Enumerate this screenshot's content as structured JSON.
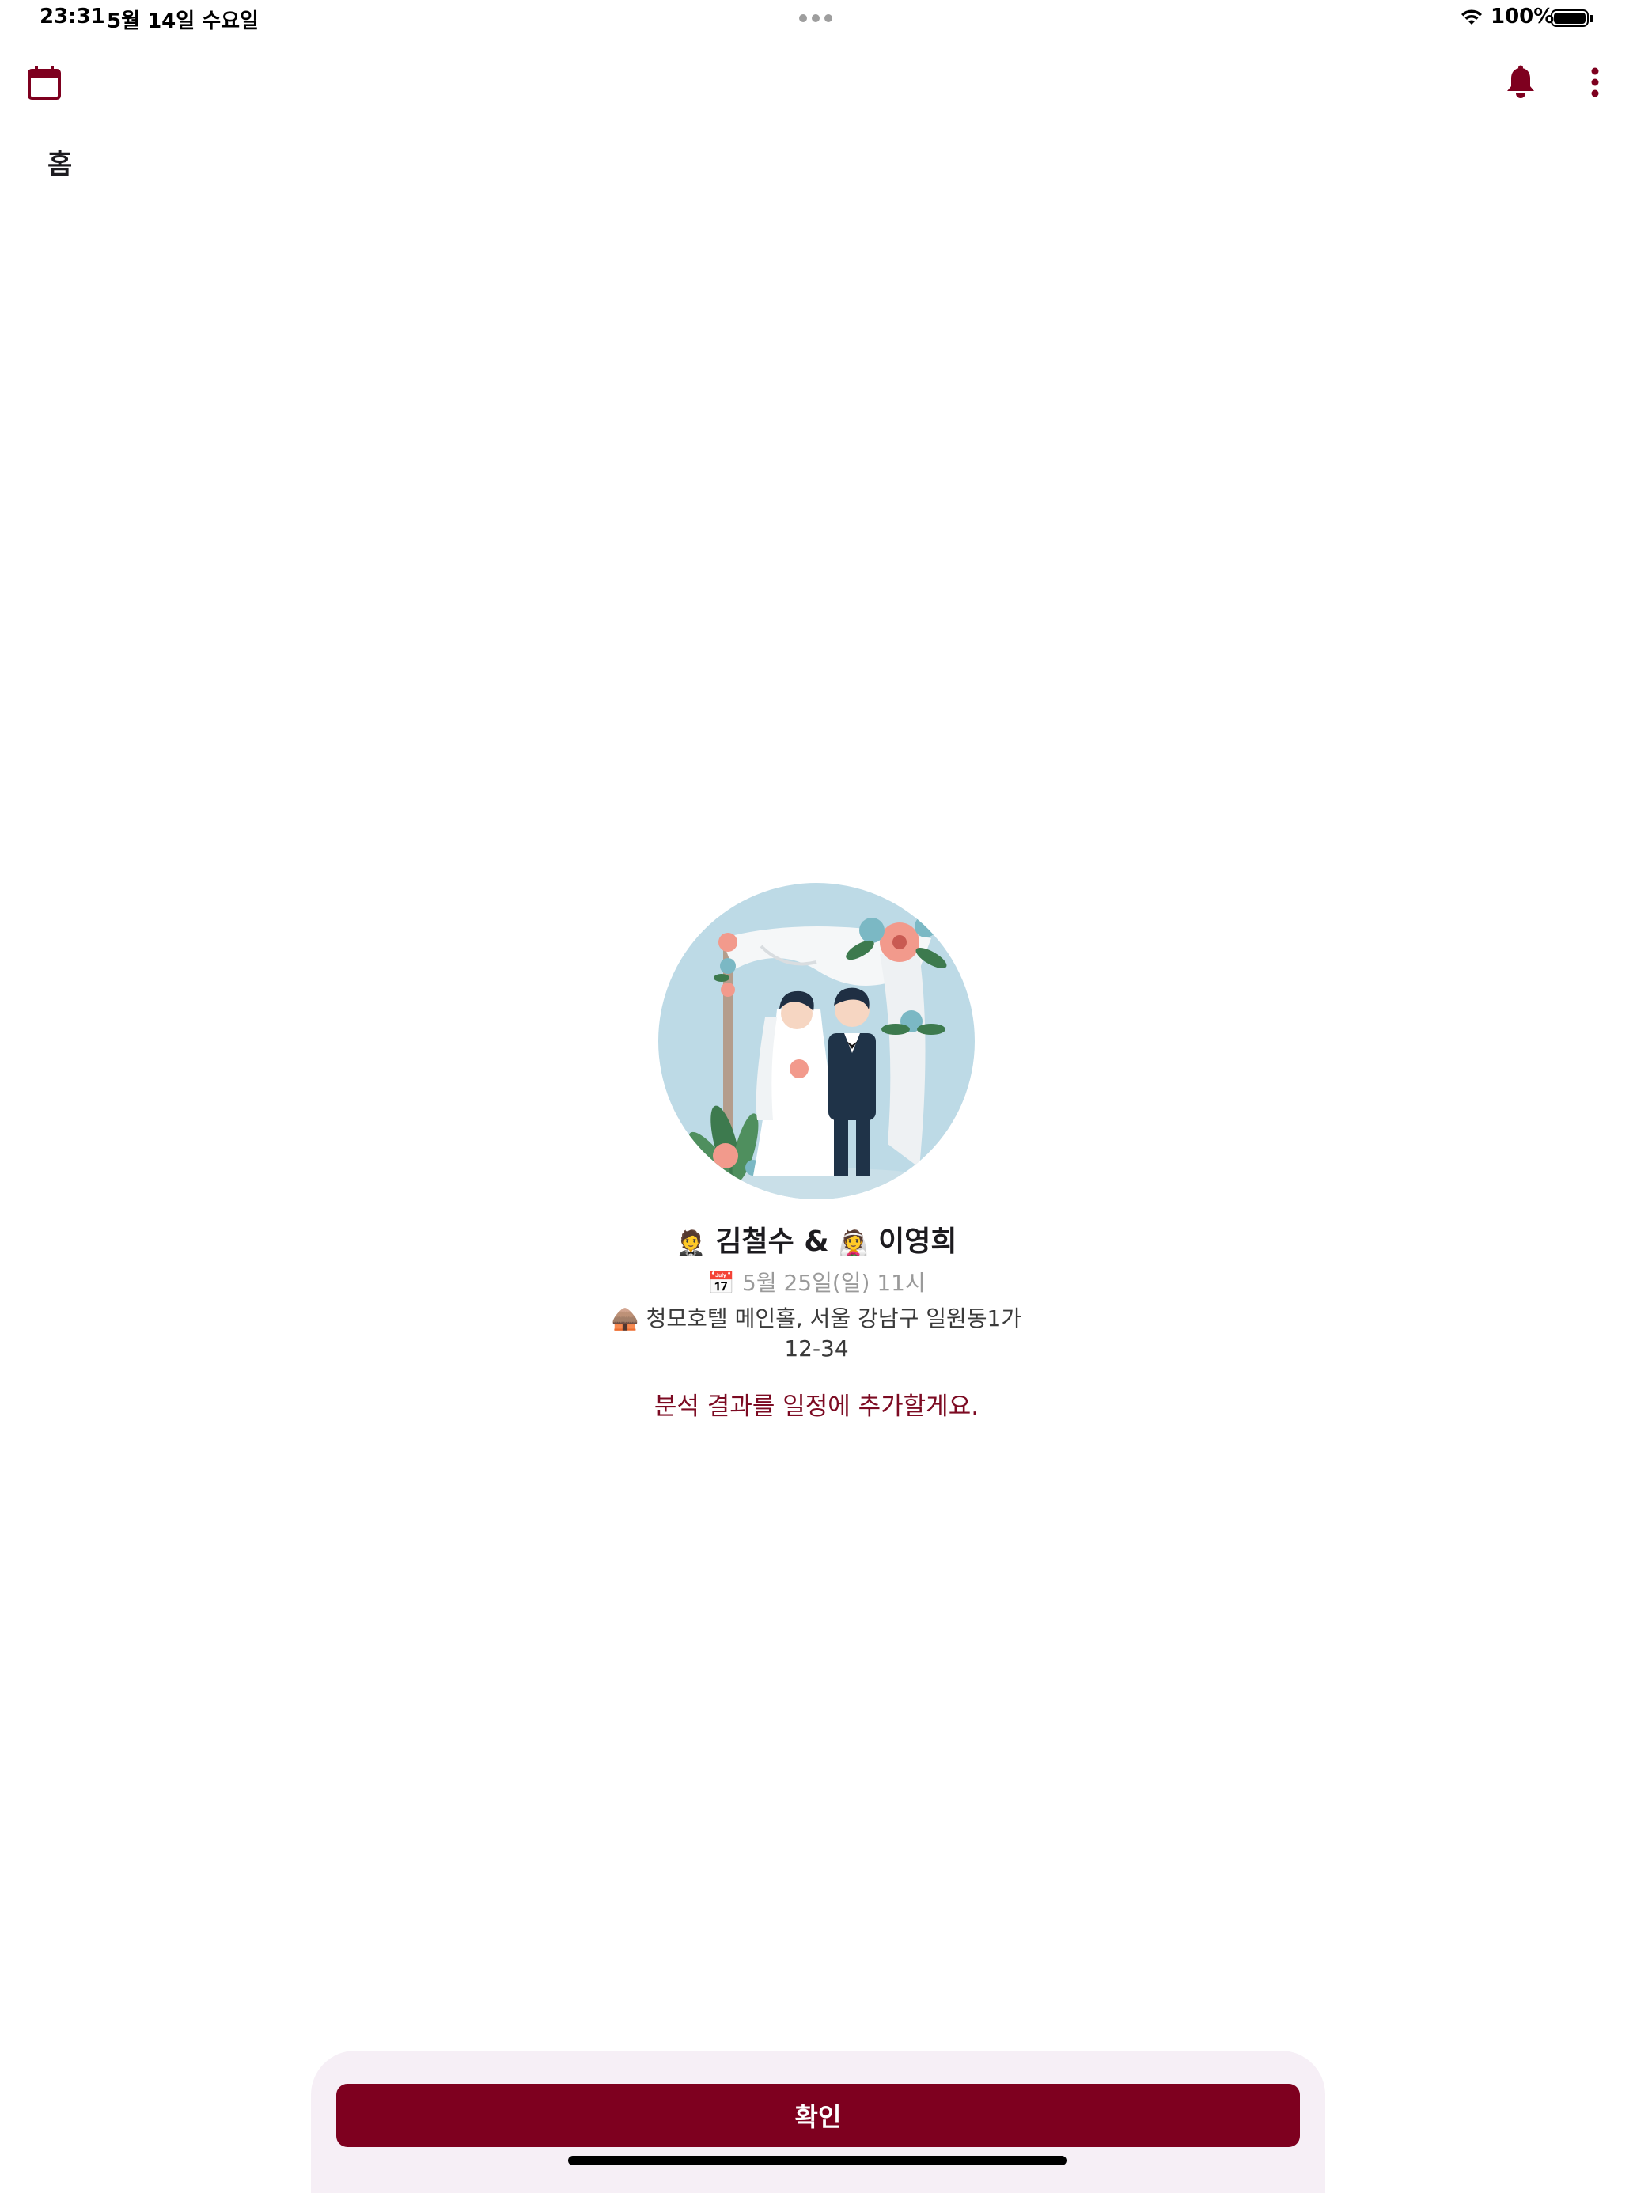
{
  "status_bar": {
    "time": "23:31",
    "date": "5월 14일 수요일",
    "battery": "100%"
  },
  "app_bar": {
    "tab_label": "홈",
    "icons": [
      "calendar-icon",
      "bell-icon",
      "more-vert-icon"
    ]
  },
  "event": {
    "groom_emoji": "🤵",
    "groom": "김철수",
    "amp": "&",
    "bride_emoji": "👰",
    "bride": "이영희",
    "date_emoji": "📅",
    "datetime": "5월 25일(일) 11시",
    "place_emoji": "🛖",
    "address_line1": "청모호텔 메인홀, 서울 강남구 일원동1가",
    "address_line2": "12-34"
  },
  "notice": "분석 결과를 일정에 추가할게요.",
  "confirm_button": "확인",
  "colors": {
    "accent": "#7e001f",
    "sheet_bg": "#f6eff6",
    "illustration_bg": "#bddae6"
  }
}
